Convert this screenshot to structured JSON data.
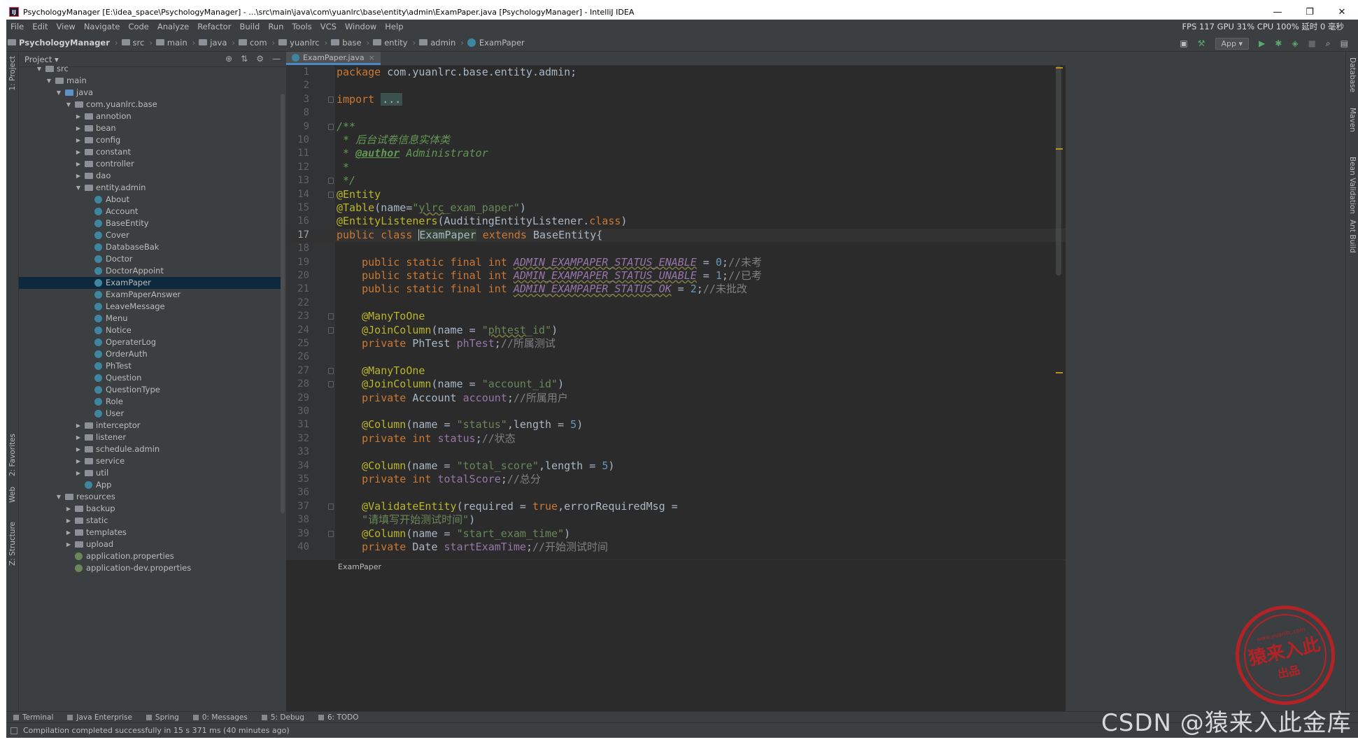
{
  "window": {
    "title": "PsychologyManager [E:\\idea_space\\PsychologyManager] - ...\\src\\main\\java\\com\\yuanlrc\\base\\entity\\admin\\ExamPaper.java [PsychologyManager] - IntelliJ IDEA",
    "app_icon": "IJ",
    "minimize": "—",
    "restore": "❐",
    "close": "✕"
  },
  "menu": [
    "File",
    "Edit",
    "View",
    "Navigate",
    "Code",
    "Analyze",
    "Refactor",
    "Build",
    "Run",
    "Tools",
    "VCS",
    "Window",
    "Help"
  ],
  "perf": "FPS 117 GPU 31% CPU 100% 延时 0 毫秒",
  "breadcrumbs": [
    "PsychologyManager",
    "src",
    "main",
    "java",
    "com",
    "yuanlrc",
    "base",
    "entity",
    "admin",
    "ExamPaper"
  ],
  "run_config": "App ▾",
  "left_stripe": {
    "project": "1: Project",
    "favorites": "2: Favorites",
    "web": "Web",
    "structure": "Z: Structure"
  },
  "right_stripe": {
    "database": "Database",
    "maven": "Maven",
    "bean": "Bean Validation",
    "ant": "Ant Build"
  },
  "project": {
    "title": "Project ▾",
    "tree": [
      {
        "label": "src",
        "depth": 1,
        "arrow": "▼",
        "icon": "folder"
      },
      {
        "label": "main",
        "depth": 2,
        "arrow": "▼",
        "icon": "folder"
      },
      {
        "label": "java",
        "depth": 3,
        "arrow": "▼",
        "icon": "src"
      },
      {
        "label": "com.yuanlrc.base",
        "depth": 4,
        "arrow": "▼",
        "icon": "pkg"
      },
      {
        "label": "annotion",
        "depth": 5,
        "arrow": "▶",
        "icon": "pkg"
      },
      {
        "label": "bean",
        "depth": 5,
        "arrow": "▶",
        "icon": "pkg"
      },
      {
        "label": "config",
        "depth": 5,
        "arrow": "▶",
        "icon": "pkg"
      },
      {
        "label": "constant",
        "depth": 5,
        "arrow": "▶",
        "icon": "pkg"
      },
      {
        "label": "controller",
        "depth": 5,
        "arrow": "▶",
        "icon": "pkg"
      },
      {
        "label": "dao",
        "depth": 5,
        "arrow": "▶",
        "icon": "pkg"
      },
      {
        "label": "entity.admin",
        "depth": 5,
        "arrow": "▼",
        "icon": "pkg"
      },
      {
        "label": "About",
        "depth": 6,
        "arrow": "",
        "icon": "cls"
      },
      {
        "label": "Account",
        "depth": 6,
        "arrow": "",
        "icon": "cls"
      },
      {
        "label": "BaseEntity",
        "depth": 6,
        "arrow": "",
        "icon": "cls"
      },
      {
        "label": "Cover",
        "depth": 6,
        "arrow": "",
        "icon": "cls"
      },
      {
        "label": "DatabaseBak",
        "depth": 6,
        "arrow": "",
        "icon": "cls"
      },
      {
        "label": "Doctor",
        "depth": 6,
        "arrow": "",
        "icon": "cls"
      },
      {
        "label": "DoctorAppoint",
        "depth": 6,
        "arrow": "",
        "icon": "cls"
      },
      {
        "label": "ExamPaper",
        "depth": 6,
        "arrow": "",
        "icon": "cls",
        "selected": true
      },
      {
        "label": "ExamPaperAnswer",
        "depth": 6,
        "arrow": "",
        "icon": "cls"
      },
      {
        "label": "LeaveMessage",
        "depth": 6,
        "arrow": "",
        "icon": "cls"
      },
      {
        "label": "Menu",
        "depth": 6,
        "arrow": "",
        "icon": "cls"
      },
      {
        "label": "Notice",
        "depth": 6,
        "arrow": "",
        "icon": "cls"
      },
      {
        "label": "OperaterLog",
        "depth": 6,
        "arrow": "",
        "icon": "cls"
      },
      {
        "label": "OrderAuth",
        "depth": 6,
        "arrow": "",
        "icon": "cls"
      },
      {
        "label": "PhTest",
        "depth": 6,
        "arrow": "",
        "icon": "cls"
      },
      {
        "label": "Question",
        "depth": 6,
        "arrow": "",
        "icon": "cls"
      },
      {
        "label": "QuestionType",
        "depth": 6,
        "arrow": "",
        "icon": "cls"
      },
      {
        "label": "Role",
        "depth": 6,
        "arrow": "",
        "icon": "cls"
      },
      {
        "label": "User",
        "depth": 6,
        "arrow": "",
        "icon": "cls"
      },
      {
        "label": "interceptor",
        "depth": 5,
        "arrow": "▶",
        "icon": "pkg"
      },
      {
        "label": "listener",
        "depth": 5,
        "arrow": "▶",
        "icon": "pkg"
      },
      {
        "label": "schedule.admin",
        "depth": 5,
        "arrow": "▶",
        "icon": "pkg"
      },
      {
        "label": "service",
        "depth": 5,
        "arrow": "▶",
        "icon": "pkg"
      },
      {
        "label": "util",
        "depth": 5,
        "arrow": "▶",
        "icon": "pkg"
      },
      {
        "label": "App",
        "depth": 5,
        "arrow": "",
        "icon": "cls"
      },
      {
        "label": "resources",
        "depth": 3,
        "arrow": "▼",
        "icon": "folder"
      },
      {
        "label": "backup",
        "depth": 4,
        "arrow": "▶",
        "icon": "folder"
      },
      {
        "label": "static",
        "depth": 4,
        "arrow": "▶",
        "icon": "folder"
      },
      {
        "label": "templates",
        "depth": 4,
        "arrow": "▶",
        "icon": "folder"
      },
      {
        "label": "upload",
        "depth": 4,
        "arrow": "▶",
        "icon": "folder"
      },
      {
        "label": "application.properties",
        "depth": 4,
        "arrow": "",
        "icon": "leaf"
      },
      {
        "label": "application-dev.properties",
        "depth": 4,
        "arrow": "",
        "icon": "leaf"
      }
    ]
  },
  "editor": {
    "tab": "ExamPaper.java",
    "current_line": 17,
    "bottom_breadcrumb": "ExamPaper",
    "lines": [
      {
        "n": "1",
        "html": "<span class=\"kw\">package</span> com.yuanlrc.base.entity.admin;"
      },
      {
        "n": "2",
        "html": ""
      },
      {
        "n": "3",
        "fold": true,
        "html": "<span class=\"kw\">import</span> <span class=\"fold-inline\">...</span>"
      },
      {
        "n": "8",
        "html": ""
      },
      {
        "n": "9",
        "fold": true,
        "html": "<span class=\"doc\">/**</span>"
      },
      {
        "n": "10",
        "html": "<span class=\"doc\"> * 后台试卷信息实体类</span>"
      },
      {
        "n": "11",
        "html": "<span class=\"doc\"> * </span><span class=\"tag\">@author</span><span class=\"doc\"> Administrator</span>"
      },
      {
        "n": "12",
        "html": "<span class=\"doc\"> *</span>"
      },
      {
        "n": "13",
        "fold": true,
        "html": "<span class=\"doc\"> */</span>"
      },
      {
        "n": "14",
        "fold": true,
        "html": "<span class=\"ann\">@Entity</span>"
      },
      {
        "n": "15",
        "html": "<span class=\"ann\">@Table</span>(name=<span class=\"str\">\"<span class=\"squig\">ylrc</span>_exam_paper\"</span>)"
      },
      {
        "n": "16",
        "html": "<span class=\"ann\">@EntityListeners</span>(AuditingEntityListener.<span class=\"kw\">class</span>)"
      },
      {
        "n": "17",
        "html": "<span class=\"kw\">public class </span><span class=\"caret\"></span><span class=\"cls\">ExamPaper</span> <span class=\"kw\">extends</span> BaseEntity{"
      },
      {
        "n": "18",
        "html": ""
      },
      {
        "n": "19",
        "html": "    <span class=\"kw\">public static final int</span> <span class=\"sfld\">ADMIN_EXAMPAPER_STATUS_ENABLE</span> = <span class=\"num\">0</span>;<span class=\"cmt2\">//未考</span>"
      },
      {
        "n": "20",
        "html": "    <span class=\"kw\">public static final int</span> <span class=\"sfld\">ADMIN_EXAMPAPER_STATUS_UNABLE</span> = <span class=\"num\">1</span>;<span class=\"cmt2\">//已考</span>"
      },
      {
        "n": "21",
        "html": "    <span class=\"kw\">public static final int</span> <span class=\"sfld\">ADMIN_EXAMPAPER_STATUS_OK</span> = <span class=\"num\">2</span>;<span class=\"cmt2\">//未批改</span>"
      },
      {
        "n": "22",
        "html": ""
      },
      {
        "n": "23",
        "fold": true,
        "html": "    <span class=\"ann\">@ManyToOne</span>"
      },
      {
        "n": "24",
        "fold": true,
        "html": "    <span class=\"ann\">@JoinColumn</span>(name = <span class=\"str\">\"<span class=\"squig\">phtest</span>_id\"</span>)"
      },
      {
        "n": "25",
        "html": "    <span class=\"kw\">private</span> PhTest <span class=\"fld\">phTest</span>;<span class=\"cmt2\">//所属测试</span>"
      },
      {
        "n": "26",
        "html": ""
      },
      {
        "n": "27",
        "fold": true,
        "html": "    <span class=\"ann\">@ManyToOne</span>"
      },
      {
        "n": "28",
        "fold": true,
        "html": "    <span class=\"ann\">@JoinColumn</span>(name = <span class=\"str\">\"account_id\"</span>)"
      },
      {
        "n": "29",
        "html": "    <span class=\"kw\">private</span> Account <span class=\"fld\">account</span>;<span class=\"cmt2\">//所属用户</span>"
      },
      {
        "n": "30",
        "html": ""
      },
      {
        "n": "31",
        "html": "    <span class=\"ann\">@Column</span>(name = <span class=\"str\">\"status\"</span>,length = <span class=\"num\">5</span>)"
      },
      {
        "n": "32",
        "html": "    <span class=\"kw\">private int</span> <span class=\"fld\">status</span>;<span class=\"cmt2\">//状态</span>"
      },
      {
        "n": "33",
        "html": ""
      },
      {
        "n": "34",
        "html": "    <span class=\"ann\">@Column</span>(name = <span class=\"str\">\"total_score\"</span>,length = <span class=\"num\">5</span>)"
      },
      {
        "n": "35",
        "html": "    <span class=\"kw\">private int</span> <span class=\"fld\">totalScore</span>;<span class=\"cmt2\">//总分</span>"
      },
      {
        "n": "36",
        "html": ""
      },
      {
        "n": "37",
        "fold": true,
        "html": "    <span class=\"ann\">@ValidateEntity</span>(required = <span class=\"kw\">true</span>,errorRequiredMsg ="
      },
      {
        "n": "38",
        "html": "    <span class=\"str\">\"请填写开始测试时间\"</span>)"
      },
      {
        "n": "39",
        "fold": true,
        "html": "    <span class=\"ann\">@Column</span>(name = <span class=\"str\">\"start_exam_time\"</span>)"
      },
      {
        "n": "40",
        "html": "    <span class=\"kw\">private</span> Date <span class=\"fld\">startExamTime</span>;<span class=\"cmt2\">//开始测试时间</span>"
      }
    ]
  },
  "tool_tabs": [
    "Terminal",
    "Java Enterprise",
    "Spring",
    "0: Messages",
    "5: Debug",
    "6: TODO"
  ],
  "status": "Compilation completed successfully in 15 s 371 ms (40 minutes ago)",
  "watermark": "CSDN @猿来入此金库",
  "seal": {
    "url": "www.yuanlrc.com",
    "main": "猿来入此",
    "sub": "出品"
  }
}
